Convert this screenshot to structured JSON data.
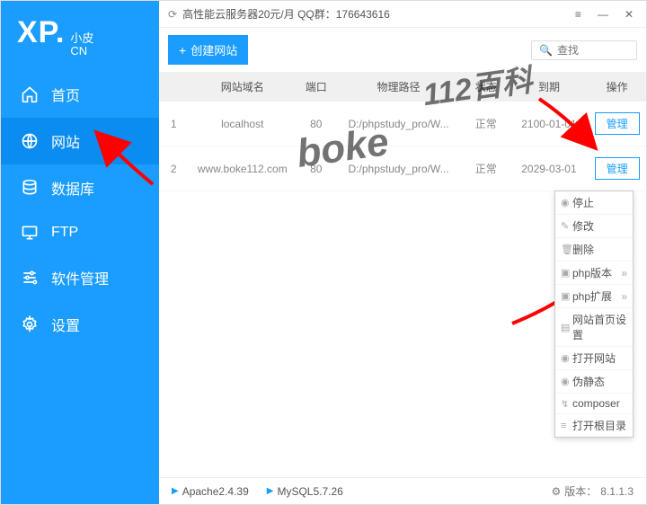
{
  "logo": {
    "prefix": "XP.",
    "line1": "小皮",
    "line2": "CN"
  },
  "sidebar": {
    "items": [
      {
        "label": "首页"
      },
      {
        "label": "网站"
      },
      {
        "label": "数据库"
      },
      {
        "label": "FTP"
      },
      {
        "label": "软件管理"
      },
      {
        "label": "设置"
      }
    ]
  },
  "titlebar": {
    "text": "高性能云服务器20元/月  QQ群：176643616"
  },
  "toolbar": {
    "newsite_label": "创建网站",
    "search_placeholder": "查找"
  },
  "table": {
    "headers": {
      "idx": "",
      "domain": "网站域名",
      "port": "端口",
      "path": "物理路径",
      "status": "状态",
      "expire": "到期",
      "action": "操作"
    },
    "rows": [
      {
        "idx": "1",
        "domain": "localhost",
        "port": "80",
        "path": "D:/phpstudy_pro/W...",
        "status": "正常",
        "expire": "2100-01-01",
        "action": "管理"
      },
      {
        "idx": "2",
        "domain": "www.boke112.com",
        "port": "80",
        "path": "D:/phpstudy_pro/W...",
        "status": "正常",
        "expire": "2029-03-01",
        "action": "管理"
      }
    ]
  },
  "ctx": {
    "items": [
      {
        "icon": "◉",
        "label": "停止"
      },
      {
        "icon": "✎",
        "label": "修改"
      },
      {
        "icon": "🗑",
        "label": "删除"
      },
      {
        "icon": "▣",
        "label": "php版本",
        "arrow": "»"
      },
      {
        "icon": "▣",
        "label": "php扩展",
        "arrow": "»"
      },
      {
        "icon": "▤",
        "label": "网站首页设置"
      },
      {
        "icon": "◉",
        "label": "打开网站"
      },
      {
        "icon": "◉",
        "label": "伪静态"
      },
      {
        "icon": "↯",
        "label": "composer"
      },
      {
        "icon": "≡",
        "label": "打开根目录"
      }
    ]
  },
  "statusbar": {
    "services": [
      {
        "label": "Apache2.4.39"
      },
      {
        "label": "MySQL5.7.26"
      }
    ],
    "version_label": "版本：",
    "version": "8.1.1.3"
  },
  "watermark_top": "112百科",
  "watermark_mid": "boke"
}
